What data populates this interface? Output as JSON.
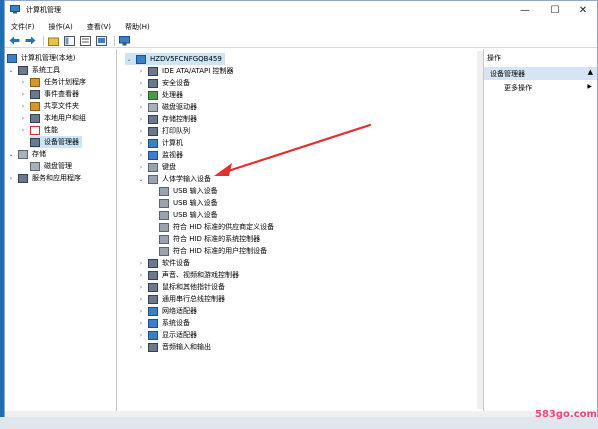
{
  "window": {
    "title": "计算机管理",
    "minimize": "—",
    "maximize": "☐",
    "close": "✕"
  },
  "menu": [
    "文件(F)",
    "操作(A)",
    "查看(V)",
    "帮助(H)"
  ],
  "left_tree": {
    "root": "计算机管理(本地)",
    "system_tools": "系统工具",
    "task_scheduler": "任务计划程序",
    "event_viewer": "事件查看器",
    "shared_folders": "共享文件夹",
    "local_users": "本地用户和组",
    "performance": "性能",
    "device_manager": "设备管理器",
    "storage": "存储",
    "disk_management": "磁盘管理",
    "services_apps": "服务和应用程序"
  },
  "device_tree": {
    "computer_name": "HZDV5FCNFGQB459",
    "categories": [
      {
        "label": "IDE ATA/ATAPI 控制器",
        "icon": "dev"
      },
      {
        "label": "安全设备",
        "icon": "dev"
      },
      {
        "label": "处理器",
        "icon": "green"
      },
      {
        "label": "磁盘驱动器",
        "icon": "disk"
      },
      {
        "label": "存储控制器",
        "icon": "dev"
      },
      {
        "label": "打印队列",
        "icon": "dev"
      },
      {
        "label": "计算机",
        "icon": "pc"
      },
      {
        "label": "监视器",
        "icon": "mon"
      },
      {
        "label": "键盘",
        "icon": "kbd"
      }
    ],
    "hid": {
      "label": "人体学输入设备",
      "children": [
        "USB 输入设备",
        "USB 输入设备",
        "USB 输入设备",
        "符合 HID 标准的供应商定义设备",
        "符合 HID 标准的系统控制器",
        "符合 HID 标准的用户控制设备"
      ]
    },
    "more_categories": [
      {
        "label": "软件设备",
        "icon": "dev"
      },
      {
        "label": "声音、视频和游戏控制器",
        "icon": "dev"
      },
      {
        "label": "鼠标和其他指针设备",
        "icon": "dev"
      },
      {
        "label": "通用串行总线控制器",
        "icon": "dev"
      },
      {
        "label": "网络适配器",
        "icon": "mon"
      },
      {
        "label": "系统设备",
        "icon": "mon"
      },
      {
        "label": "显示适配器",
        "icon": "mon"
      },
      {
        "label": "音频输入和输出",
        "icon": "dev"
      }
    ]
  },
  "actions": {
    "header": "操作",
    "group": "设备管理器",
    "more": "更多操作"
  },
  "watermark": "583go.com",
  "colors": {
    "selection": "#cce4f7",
    "arrow": "#e03030",
    "desktop": "#1f6fb0"
  }
}
